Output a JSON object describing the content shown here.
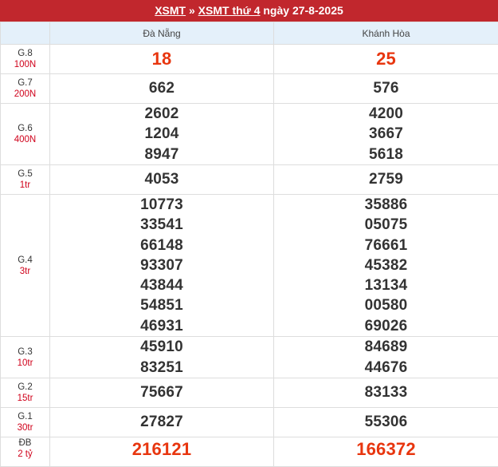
{
  "header": {
    "link1": "XSMT",
    "sep": "»",
    "link2": "XSMT thứ 4",
    "date_text": "ngày 27-8-2025"
  },
  "columns": [
    "",
    "Đà Nẵng",
    "Khánh Hòa"
  ],
  "rows": [
    {
      "name": "G.8",
      "money": "100N",
      "cols": [
        [
          "18"
        ],
        [
          "25"
        ]
      ],
      "highlight": true
    },
    {
      "name": "G.7",
      "money": "200N",
      "cols": [
        [
          "662"
        ],
        [
          "576"
        ]
      ]
    },
    {
      "name": "G.6",
      "money": "400N",
      "cols": [
        [
          "2602",
          "1204",
          "8947"
        ],
        [
          "4200",
          "3667",
          "5618"
        ]
      ]
    },
    {
      "name": "G.5",
      "money": "1tr",
      "cols": [
        [
          "4053"
        ],
        [
          "2759"
        ]
      ]
    },
    {
      "name": "G.4",
      "money": "3tr",
      "cols": [
        [
          "10773",
          "33541",
          "66148",
          "93307",
          "43844",
          "54851",
          "46931"
        ],
        [
          "35886",
          "05075",
          "76661",
          "45382",
          "13134",
          "00580",
          "69026"
        ]
      ]
    },
    {
      "name": "G.3",
      "money": "10tr",
      "cols": [
        [
          "45910",
          "83251"
        ],
        [
          "84689",
          "44676"
        ]
      ]
    },
    {
      "name": "G.2",
      "money": "15tr",
      "cols": [
        [
          "75667"
        ],
        [
          "83133"
        ]
      ]
    },
    {
      "name": "G.1",
      "money": "30tr",
      "cols": [
        [
          "27827"
        ],
        [
          "55306"
        ]
      ]
    },
    {
      "name": "ĐB",
      "money": "2 tỷ",
      "cols": [
        [
          "216121"
        ],
        [
          "166372"
        ]
      ],
      "highlight": true
    }
  ],
  "colors": {
    "header_bg": "#c1272d",
    "accent_red": "#e8360f",
    "table_head_bg": "#e4f0fa"
  }
}
